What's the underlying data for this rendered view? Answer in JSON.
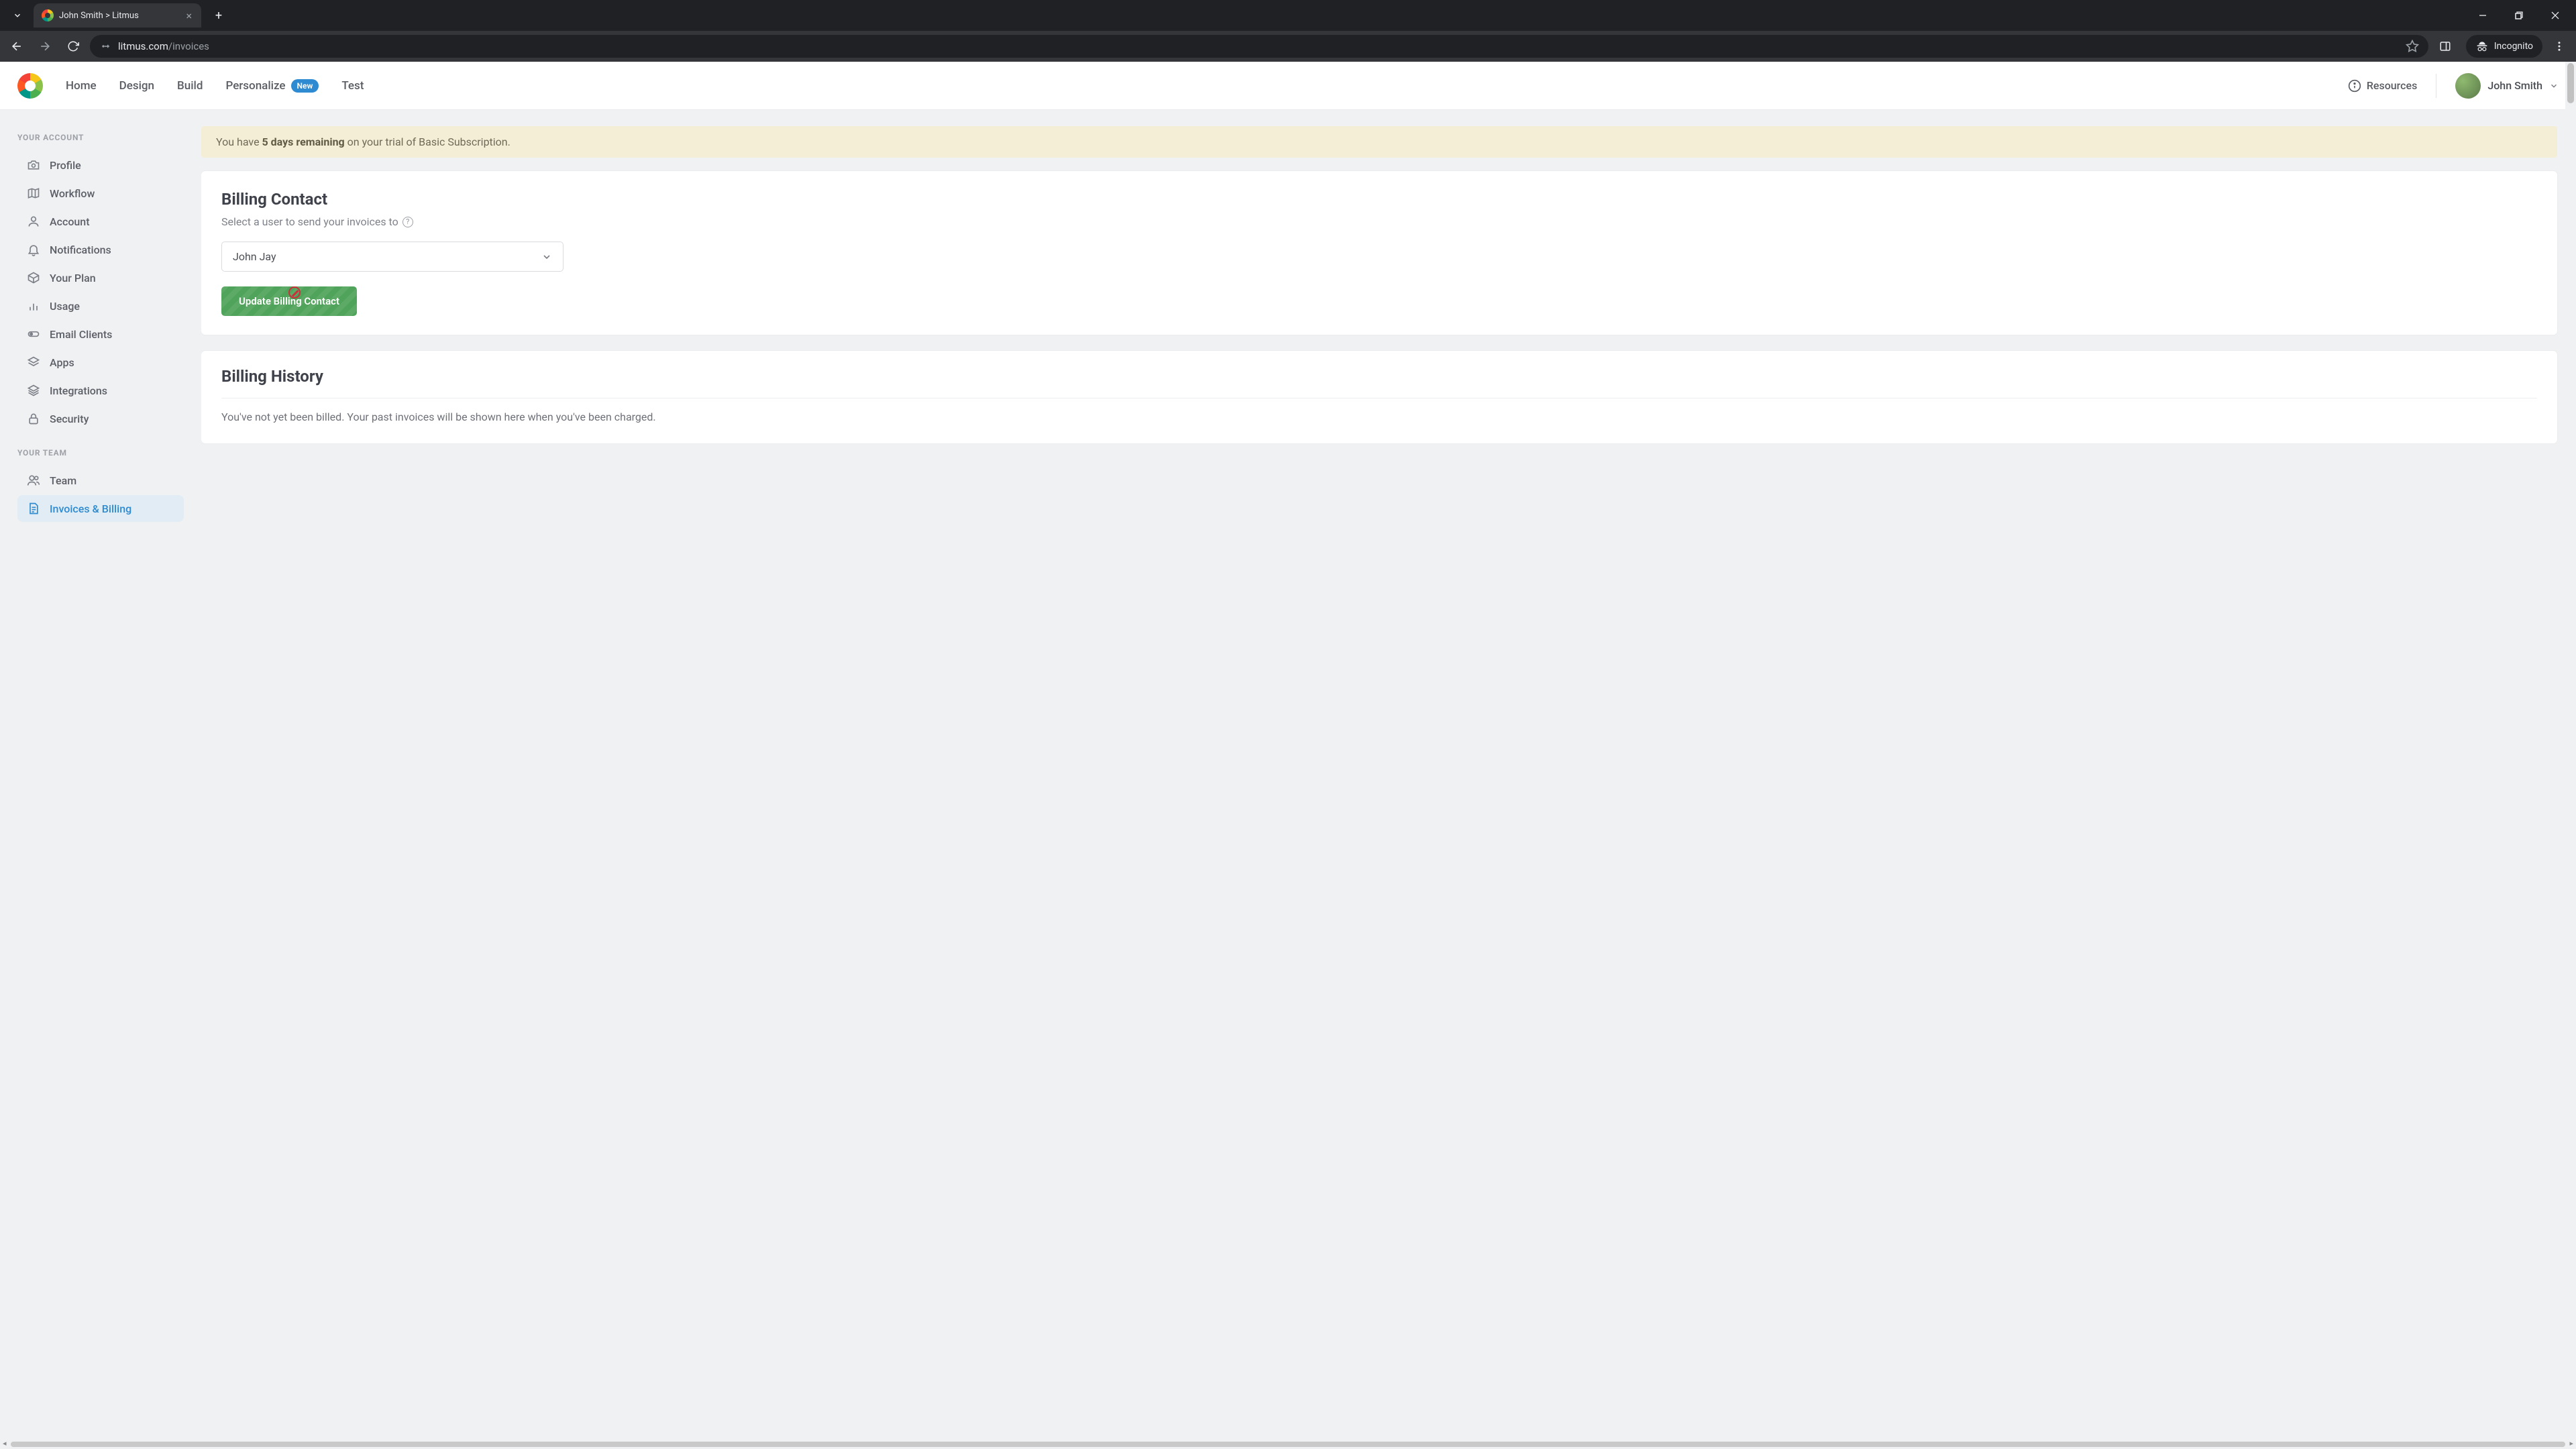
{
  "browser": {
    "tab_title": "John Smith > Litmus",
    "url_domain": "litmus.com",
    "url_path": "/invoices",
    "incognito_label": "Incognito"
  },
  "header": {
    "nav": {
      "home": "Home",
      "design": "Design",
      "build": "Build",
      "personalize": "Personalize",
      "personalize_badge": "New",
      "test": "Test"
    },
    "resources_label": "Resources",
    "user_name": "John Smith"
  },
  "sidebar": {
    "group_account": "YOUR ACCOUNT",
    "group_team": "YOUR TEAM",
    "items": {
      "profile": "Profile",
      "workflow": "Workflow",
      "account": "Account",
      "notifications": "Notifications",
      "your_plan": "Your Plan",
      "usage": "Usage",
      "email_clients": "Email Clients",
      "apps": "Apps",
      "integrations": "Integrations",
      "security": "Security",
      "team": "Team",
      "invoices": "Invoices & Billing"
    }
  },
  "banner": {
    "prefix": "You have ",
    "bold": "5 days remaining",
    "suffix": " on your trial of Basic Subscription."
  },
  "billing_contact": {
    "title": "Billing Contact",
    "subtitle": "Select a user to send your invoices to",
    "selected": "John Jay",
    "button": "Update Billing Contact"
  },
  "billing_history": {
    "title": "Billing History",
    "body": "You've not yet been billed. Your past invoices will be shown here when you've been charged."
  }
}
